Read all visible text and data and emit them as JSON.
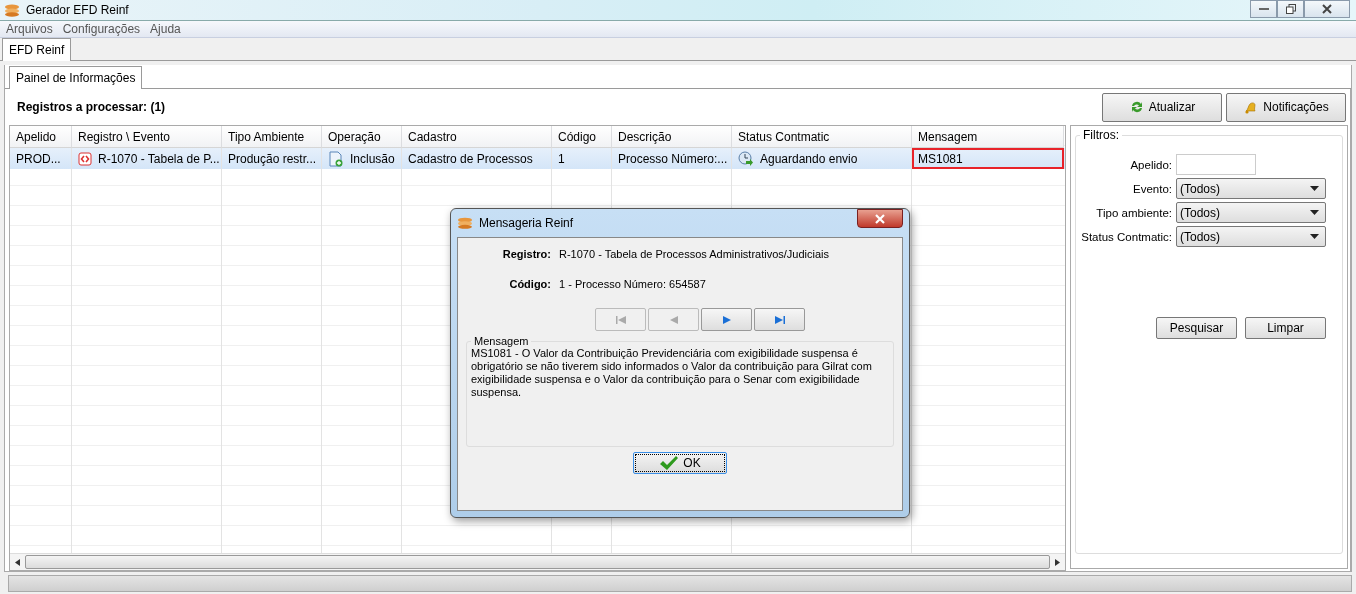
{
  "window": {
    "title": "Gerador EFD Reinf"
  },
  "menu": [
    "Arquivos",
    "Configurações",
    "Ajuda"
  ],
  "tabs": [
    {
      "label": "EFD Reinf",
      "selected": true
    }
  ],
  "subtabs": [
    {
      "label": "Painel de Informações",
      "selected": true
    }
  ],
  "header": "Registros a processar: (1)",
  "actions": [
    "Atualizar",
    "Notificações"
  ],
  "table": {
    "columns": [
      "Apelido",
      "Registro \\ Evento",
      "Tipo Ambiente",
      "Operação",
      "Cadastro",
      "Código",
      "Descrição",
      "Status Contmatic",
      "Mensagem"
    ],
    "rows": [
      {
        "selected": true,
        "cells": [
          {
            "text": "PROD...",
            "highlighted": false
          },
          {
            "text": "R-1070 - Tabela de P...",
            "highlighted": false
          },
          {
            "text": "Produção restr...",
            "highlighted": false
          },
          {
            "text": "Inclusão",
            "highlighted": false
          },
          {
            "text": "Cadastro de Processos",
            "highlighted": false
          },
          {
            "text": "1",
            "highlighted": false
          },
          {
            "text": "Processo Número:...",
            "highlighted": false
          },
          {
            "text": "Aguardando envio",
            "highlighted": false
          },
          {
            "text": "MS1081",
            "highlighted": true
          }
        ]
      }
    ]
  },
  "filters": {
    "title": "Filtros:",
    "fields": [
      {
        "kind": "text",
        "label": "Apelido:"
      },
      {
        "kind": "select",
        "label": "Evento:",
        "value": "(Todos)"
      },
      {
        "kind": "select",
        "label": "Tipo ambiente:",
        "value": "(Todos)"
      },
      {
        "kind": "select",
        "label": "Status Contmatic:",
        "value": "(Todos)"
      }
    ],
    "buttons": [
      "Pesquisar",
      "Limpar"
    ]
  },
  "dialog": {
    "title": "Mensageria Reinf",
    "fields": [
      {
        "label": "Registro:",
        "value": "R-1070 - Tabela de Processos Administrativos/Judiciais"
      },
      {
        "label": "Código:",
        "value": "1 - Processo Número: 654587"
      }
    ],
    "nav": [
      {
        "kind": "first",
        "disabled": true
      },
      {
        "kind": "prev",
        "disabled": true
      },
      {
        "kind": "next",
        "disabled": false
      },
      {
        "kind": "last",
        "disabled": false
      }
    ],
    "message_title": "Mensagem",
    "message": "MS1081 - O Valor da Contribuição Previdenciária com exigibilidade suspensa é obrigatório se não tiverem sido informados o Valor da contribuição para Gilrat com exigibilidade suspensa e o Valor da contribuição para o Senar com exigibilidade suspensa.",
    "ok": "OK"
  }
}
